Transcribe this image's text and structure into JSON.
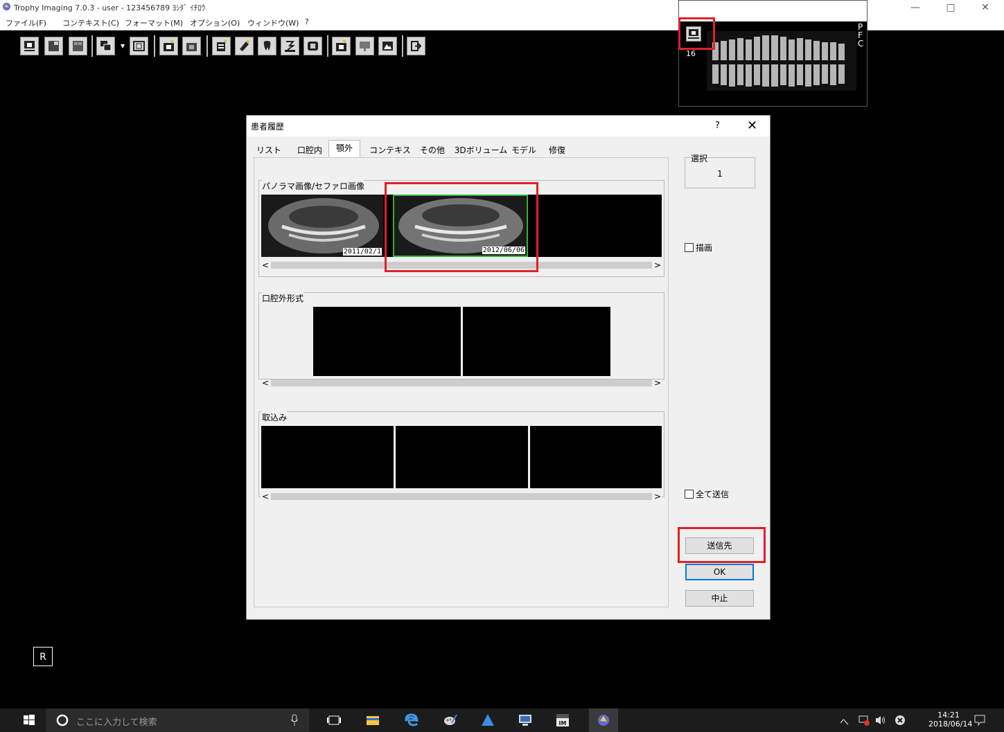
{
  "window": {
    "title": "Trophy Imaging 7.0.3 - user  - 123456789 ﾖｼﾀﾞ ｲﾁﾛｳ",
    "minimize": "—",
    "maximize": "□",
    "close": "✕"
  },
  "menu": [
    "ファイル(F)",
    "コンテキスト(C)",
    "フォーマット(M)",
    "オプション(O)",
    "ウィンドウ(W)",
    "?"
  ],
  "thumbnail_window": {
    "count": "16",
    "side_letters": "P\nF\nC"
  },
  "viewer": {
    "orientation_label": "R"
  },
  "dialog": {
    "title": "患者履歴",
    "help": "?",
    "close": "✕",
    "tabs": [
      "リスト",
      "口腔内",
      "顎外",
      "コンテキスト",
      "その他",
      "3Dボリューム",
      "モデル",
      "修復"
    ],
    "active_tab": "顎外",
    "groups": {
      "pano": {
        "label": "パノラマ画像/セファロ画像",
        "images": [
          {
            "date": "2011/02/1"
          },
          {
            "date": "2012/06/06"
          }
        ]
      },
      "extraoral": {
        "label": "口腔外形式"
      },
      "capture": {
        "label": "取込み"
      }
    },
    "scroll_left": "<",
    "scroll_right": ">",
    "selection": {
      "label": "選択",
      "value": "1"
    },
    "draw_checkbox": "描画",
    "send_all_checkbox": "全て送信",
    "buttons": {
      "send_to": "送信先",
      "ok": "OK",
      "cancel": "中止"
    }
  },
  "taskbar": {
    "search_placeholder": "ここに入力して検索",
    "tray": "へ",
    "time": "14:21",
    "date": "2018/06/14"
  }
}
